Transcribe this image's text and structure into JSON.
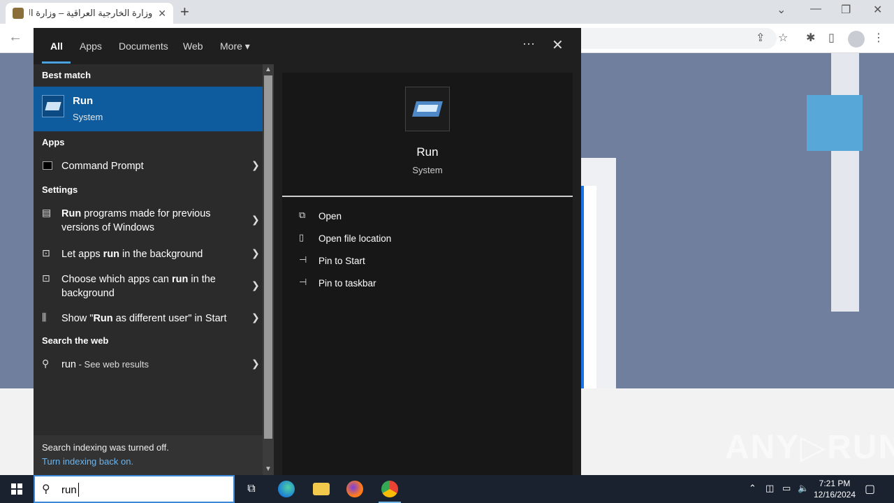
{
  "browser": {
    "tab_title": "وزارة الخارجية العراقية – وزارة الخارجية",
    "tab_close": "✕",
    "new_tab": "+"
  },
  "search": {
    "tabs": [
      "All",
      "Apps",
      "Documents",
      "Web",
      "More"
    ],
    "more_caret": "▾",
    "more_dots": "···",
    "close": "✕",
    "best_match_header": "Best match",
    "best_match": {
      "name": "Run",
      "sub": "System"
    },
    "apps_header": "Apps",
    "apps": [
      {
        "label": "Command Prompt"
      }
    ],
    "settings_header": "Settings",
    "settings": [
      {
        "pre": "",
        "bold": "Run",
        "post": " programs made for previous versions of Windows"
      },
      {
        "pre": "Let apps ",
        "bold": "run",
        "post": " in the background"
      },
      {
        "pre": "Choose which apps can ",
        "bold": "run",
        "post": " in the background"
      },
      {
        "pre": "Show \"",
        "bold": "Run",
        "post": " as different user\" in Start"
      }
    ],
    "web_header": "Search the web",
    "web": {
      "query": "run",
      "suffix": " - See web results"
    },
    "indexing_line1": "Search indexing was turned off.",
    "indexing_line2": "Turn indexing back on.",
    "detail": {
      "name": "Run",
      "sub": "System",
      "actions": [
        "Open",
        "Open file location",
        "Pin to Start",
        "Pin to taskbar"
      ]
    }
  },
  "taskbar": {
    "search_text": "run",
    "time": "7:21 PM",
    "date": "12/16/2024"
  },
  "watermark": "ANY▷RUN",
  "colors": {
    "accent": "#0e5c9e",
    "link": "#6cb4ee",
    "taskbar": "#1a2230"
  }
}
